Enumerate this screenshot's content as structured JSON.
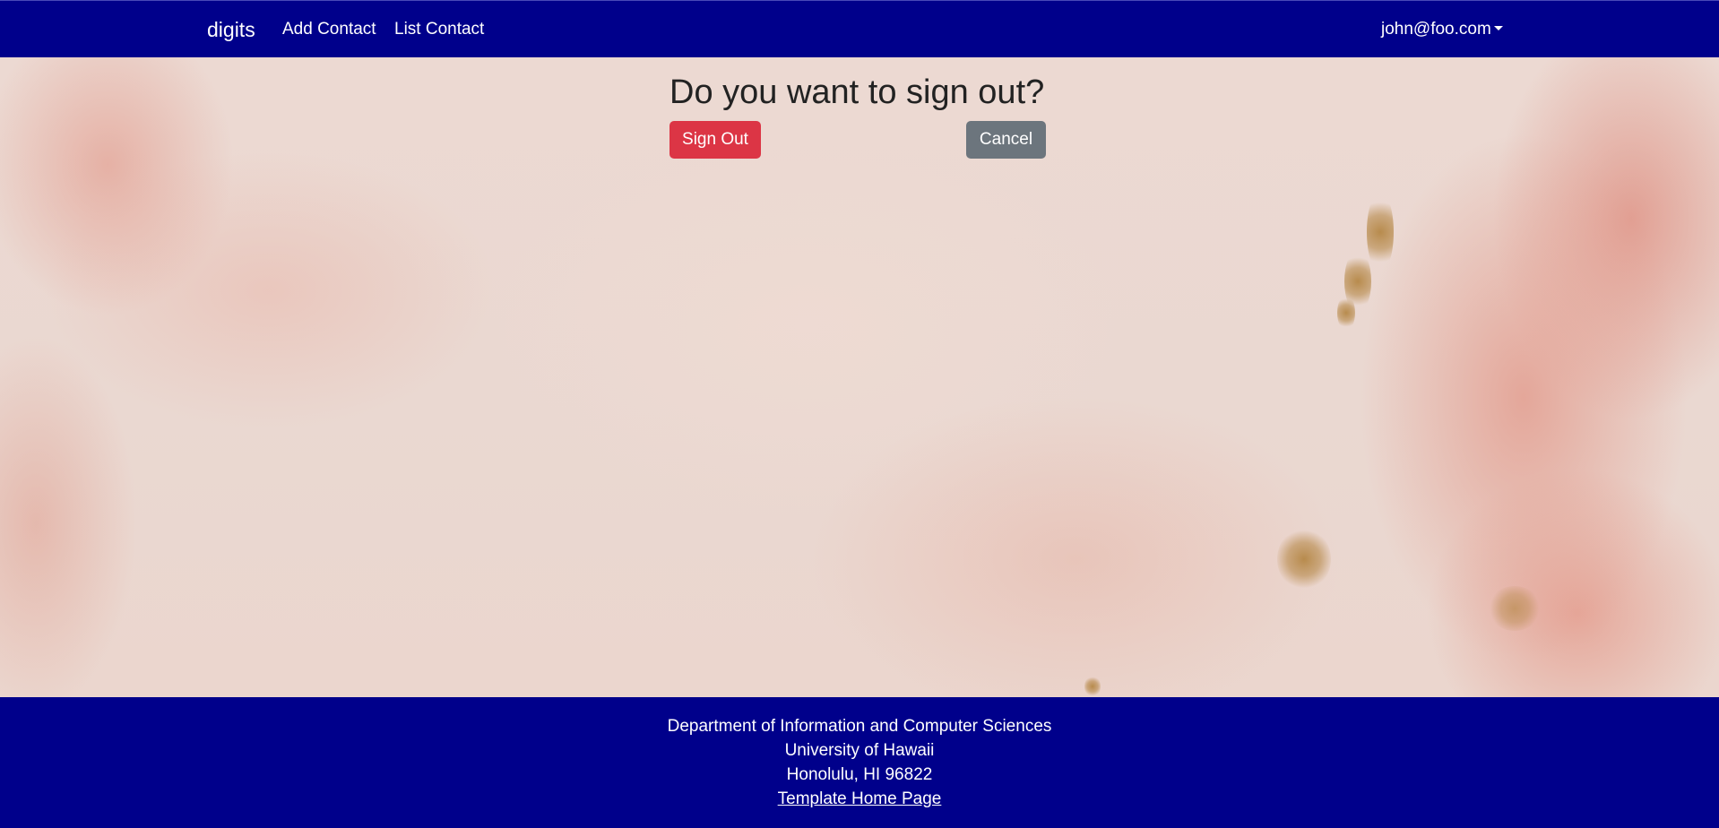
{
  "navbar": {
    "brand": "digits",
    "links": [
      {
        "label": "Add Contact"
      },
      {
        "label": "List Contact"
      }
    ],
    "user": {
      "email": "john@foo.com"
    },
    "colors": {
      "background": "#00008b",
      "text": "#ffffff"
    }
  },
  "signout": {
    "title": "Do you want to sign out?",
    "confirm_label": "Sign Out",
    "cancel_label": "Cancel",
    "colors": {
      "confirm": "#dc3545",
      "cancel": "#6c757d"
    }
  },
  "footer": {
    "lines": [
      "Department of Information and Computer Sciences",
      "University of Hawaii",
      "Honolulu, HI 96822"
    ],
    "link_label": "Template Home Page"
  }
}
